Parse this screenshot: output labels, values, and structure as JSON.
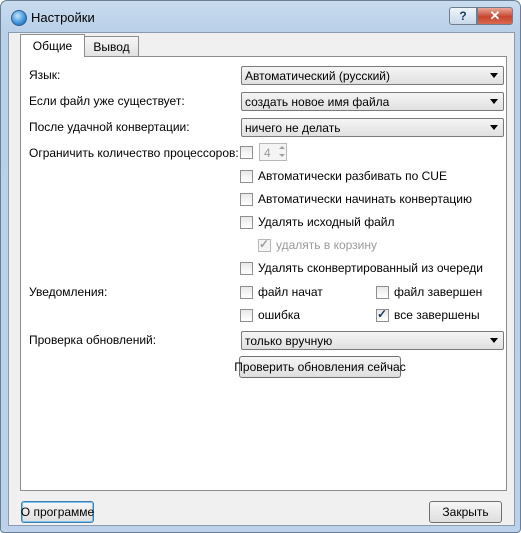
{
  "window": {
    "title": "Настройки",
    "help_label": "?",
    "close_label": "✕"
  },
  "tabs": [
    {
      "label": "Общие"
    },
    {
      "label": "Вывод"
    }
  ],
  "general": {
    "language_label": "Язык:",
    "language_value": "Автоматический (русский)",
    "if_exists_label": "Если файл уже существует:",
    "if_exists_value": "создать новое имя файла",
    "after_conversion_label": "После удачной конвертации:",
    "after_conversion_value": "ничего не делать",
    "limit_cpu_label": "Ограничить количество процессоров:",
    "cpu_count": "4",
    "split_cue_label": "Автоматически разбивать по CUE",
    "auto_start_label": "Автоматически начинать конвертацию",
    "delete_source_label": "Удалять исходный файл",
    "to_trash_label": "удалять в корзину",
    "remove_converted_label": "Удалять сконвертированный из очереди",
    "notifications_label": "Уведомления:",
    "notify_file_started": "файл начат",
    "notify_file_finished": "файл завершен",
    "notify_error": "ошибка",
    "notify_all_finished": "все завершены",
    "updates_label": "Проверка обновлений:",
    "updates_value": "только вручную",
    "check_updates_button": "Проверить обновления сейчас"
  },
  "footer": {
    "about_button": "О программе",
    "close_button": "Закрыть"
  }
}
